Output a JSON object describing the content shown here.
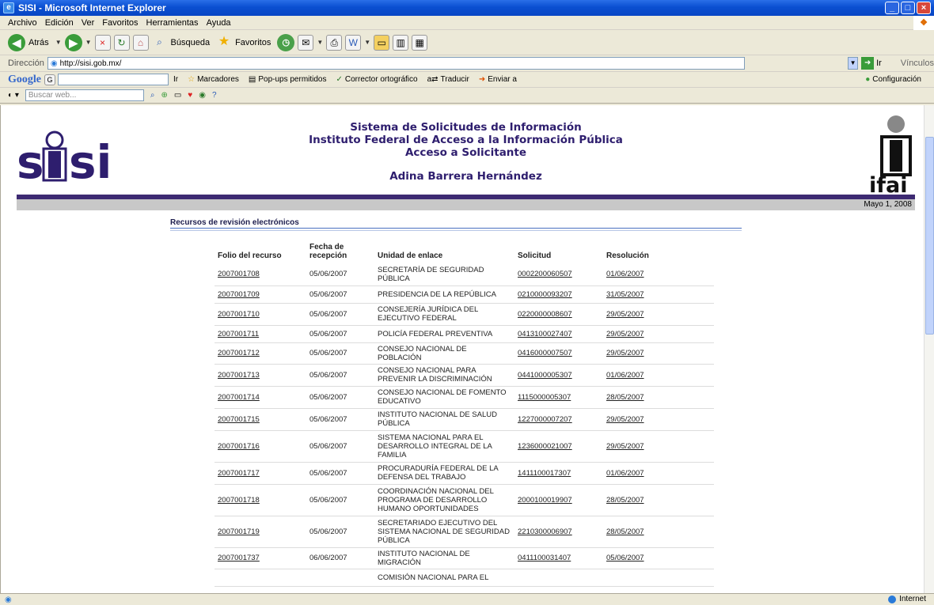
{
  "window": {
    "title": "SISI - Microsoft Internet Explorer",
    "minimize": "_",
    "maximize": "□",
    "close": "×"
  },
  "menu": [
    "Archivo",
    "Edición",
    "Ver",
    "Favoritos",
    "Herramientas",
    "Ayuda"
  ],
  "toolbar": {
    "back": "Atrás",
    "search": "Búsqueda",
    "favorites": "Favoritos"
  },
  "address": {
    "label": "Dirección",
    "url": "http://sisi.gob.mx/",
    "go": "Ir",
    "links": "Vínculos"
  },
  "google_bar": {
    "brand": "Google",
    "go": "Ir",
    "bookmarks": "Marcadores",
    "popups": "Pop-ups permitidos",
    "spell": "Corrector ortográfico",
    "translate": "Traducir",
    "send": "Enviar a",
    "settings": "Configuración"
  },
  "search_bar": {
    "placeholder": "Buscar web..."
  },
  "header": {
    "line1": "Sistema de Solicitudes de Información",
    "line2": "Instituto Federal de Acceso a la Información Pública",
    "line3": "Acceso a Solicitante",
    "user": "Adina Barrera Hernández",
    "left_logo": "sisi",
    "right_logo": "ifai",
    "date": "Mayo 1, 2008"
  },
  "section_title": "Recursos de revisión electrónicos",
  "table": {
    "headers": [
      "Folio del recurso",
      "Fecha de recepción",
      "Unidad de enlace",
      "Solicitud",
      "Resolución"
    ],
    "rows": [
      {
        "folio": "2007001708",
        "fecha": "05/06/2007",
        "unidad": "SECRETARÍA DE SEGURIDAD PÚBLICA",
        "solicitud": "0002200060507",
        "resolucion": "01/06/2007"
      },
      {
        "folio": "2007001709",
        "fecha": "05/06/2007",
        "unidad": "PRESIDENCIA DE LA REPÚBLICA",
        "solicitud": "0210000093207",
        "resolucion": "31/05/2007"
      },
      {
        "folio": "2007001710",
        "fecha": "05/06/2007",
        "unidad": "CONSEJERÍA JURÍDICA DEL EJECUTIVO FEDERAL",
        "solicitud": "0220000008607",
        "resolucion": "29/05/2007"
      },
      {
        "folio": "2007001711",
        "fecha": "05/06/2007",
        "unidad": "POLICÍA FEDERAL PREVENTIVA",
        "solicitud": "0413100027407",
        "resolucion": "29/05/2007"
      },
      {
        "folio": "2007001712",
        "fecha": "05/06/2007",
        "unidad": "CONSEJO NACIONAL DE POBLACIÓN",
        "solicitud": "0416000007507",
        "resolucion": "29/05/2007"
      },
      {
        "folio": "2007001713",
        "fecha": "05/06/2007",
        "unidad": "CONSEJO NACIONAL PARA PREVENIR LA DISCRIMINACIÓN",
        "solicitud": "0441000005307",
        "resolucion": "01/06/2007"
      },
      {
        "folio": "2007001714",
        "fecha": "05/06/2007",
        "unidad": "CONSEJO NACIONAL DE FOMENTO EDUCATIVO",
        "solicitud": "1115000005307",
        "resolucion": "28/05/2007"
      },
      {
        "folio": "2007001715",
        "fecha": "05/06/2007",
        "unidad": "INSTITUTO NACIONAL DE SALUD PÚBLICA",
        "solicitud": "1227000007207",
        "resolucion": "29/05/2007"
      },
      {
        "folio": "2007001716",
        "fecha": "05/06/2007",
        "unidad": "SISTEMA NACIONAL PARA EL DESARROLLO INTEGRAL DE LA FAMILIA",
        "solicitud": "1236000021007",
        "resolucion": "29/05/2007"
      },
      {
        "folio": "2007001717",
        "fecha": "05/06/2007",
        "unidad": "PROCURADURÍA FEDERAL DE LA DEFENSA DEL TRABAJO",
        "solicitud": "1411100017307",
        "resolucion": "01/06/2007"
      },
      {
        "folio": "2007001718",
        "fecha": "05/06/2007",
        "unidad": "COORDINACIÓN NACIONAL DEL PROGRAMA DE DESARROLLO HUMANO OPORTUNIDADES",
        "solicitud": "2000100019907",
        "resolucion": "28/05/2007"
      },
      {
        "folio": "2007001719",
        "fecha": "05/06/2007",
        "unidad": "SECRETARIADO EJECUTIVO DEL SISTEMA NACIONAL DE SEGURIDAD PÚBLICA",
        "solicitud": "2210300006907",
        "resolucion": "28/05/2007"
      },
      {
        "folio": "2007001737",
        "fecha": "06/06/2007",
        "unidad": "INSTITUTO NACIONAL DE MIGRACIÓN",
        "solicitud": "0411100031407",
        "resolucion": "05/06/2007"
      },
      {
        "folio": "",
        "fecha": "",
        "unidad": "COMISIÓN NACIONAL PARA EL",
        "solicitud": "",
        "resolucion": ""
      }
    ]
  },
  "status": {
    "zone": "Internet"
  },
  "colors": {
    "title_blue": "#0a4fd1",
    "header_purple": "#2e1e6e",
    "band_purple": "#3d2a72"
  }
}
